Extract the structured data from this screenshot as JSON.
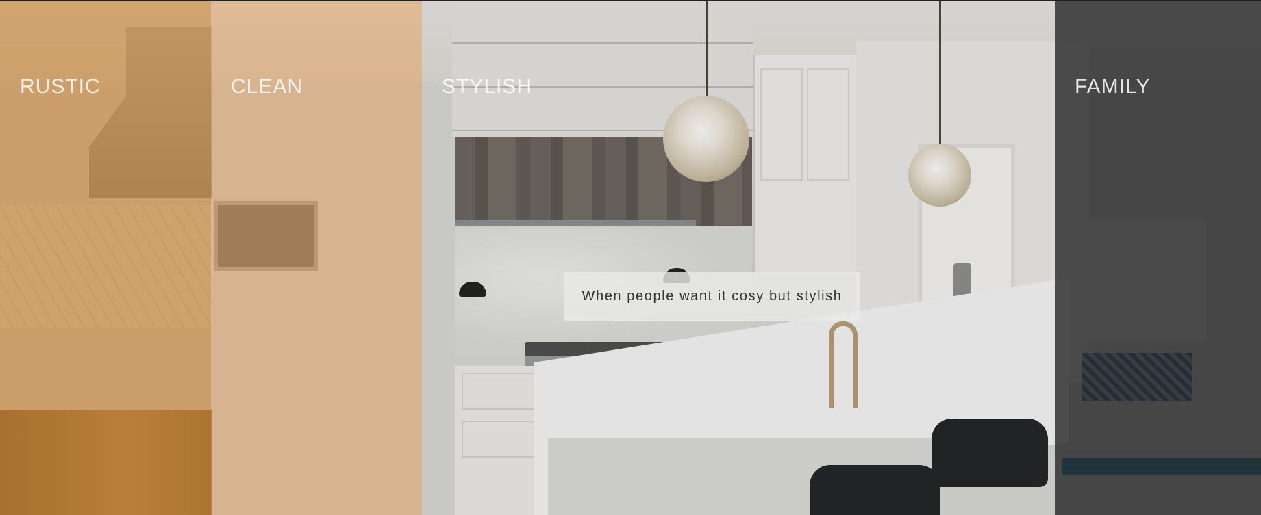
{
  "panels": [
    {
      "id": "rustic",
      "label": "RUSTIC",
      "tint": "rgba(196,124,40,0.62)"
    },
    {
      "id": "clean",
      "label": "CLEAN",
      "tint": "rgba(215,150,85,0.55)"
    },
    {
      "id": "stylish",
      "label": "STYLISH",
      "tint": "rgba(60,60,60,0.10)",
      "tagline": "When people want it cosy but stylish"
    },
    {
      "id": "family",
      "label": "FAMILY",
      "tint": "rgba(28,28,30,0.78)"
    }
  ],
  "colors": {
    "rustic_tint": "#c47c28",
    "clean_tint": "#d79655",
    "family_tint": "#1c1c1e",
    "tagline_box": "#e9e9e8",
    "label_text": "#ffffff"
  }
}
